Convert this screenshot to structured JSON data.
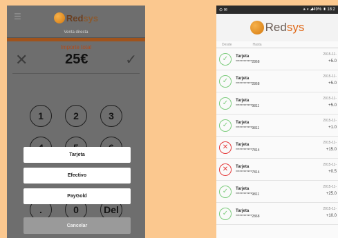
{
  "left_phone": {
    "menu_icon": "hamburger-menu-icon",
    "logo": {
      "text_main": "Red",
      "text_accent": "sys"
    },
    "subtitle": "Venta directa",
    "amount_label": "Importe total",
    "amount": "25€",
    "keypad": [
      "1",
      "2",
      "3",
      "4",
      "5",
      "6",
      ".",
      "0",
      "Del"
    ],
    "payment_options": [
      "Tarjeta",
      "Efectivo",
      "PayGold"
    ],
    "cancel_label": "Cancelar"
  },
  "right_phone": {
    "status_left": "⊙ ✉",
    "status_right": "⚹ ▾ ◢49% ▮ 18:2",
    "logo": {
      "text_main": "Red",
      "text_accent": "sys"
    },
    "filter": {
      "from": "Desde",
      "to": "Hasta"
    },
    "transactions": [
      {
        "type": "Tarjeta",
        "card": "************2868",
        "date": "2015-11-",
        "amount": "+5.0",
        "status": "ok"
      },
      {
        "type": "Tarjeta",
        "card": "************2868",
        "date": "2015-11-",
        "amount": "+5.0",
        "status": "ok"
      },
      {
        "type": "Tarjeta",
        "card": "************9811",
        "date": "2015-11-",
        "amount": "+5.0",
        "status": "ok"
      },
      {
        "type": "Tarjeta",
        "card": "************9811",
        "date": "2015-11-",
        "amount": "+1.0",
        "status": "ok"
      },
      {
        "type": "Tarjeta",
        "card": "************7814",
        "date": "2015-11-",
        "amount": "+15.0",
        "status": "fail"
      },
      {
        "type": "Tarjeta",
        "card": "************7814",
        "date": "2015-11-",
        "amount": "+0.5",
        "status": "fail"
      },
      {
        "type": "Tarjeta",
        "card": "************9811",
        "date": "2015-11-",
        "amount": "+25.0",
        "status": "ok"
      },
      {
        "type": "Tarjeta",
        "card": "************2868",
        "date": "2015-11-",
        "amount": "+10.0",
        "status": "ok"
      }
    ]
  },
  "colors": {
    "background": "#fbc88f",
    "brand_orange": "#e06a1a",
    "success_green": "#7ccc7c",
    "error_red": "#e53a3a"
  }
}
